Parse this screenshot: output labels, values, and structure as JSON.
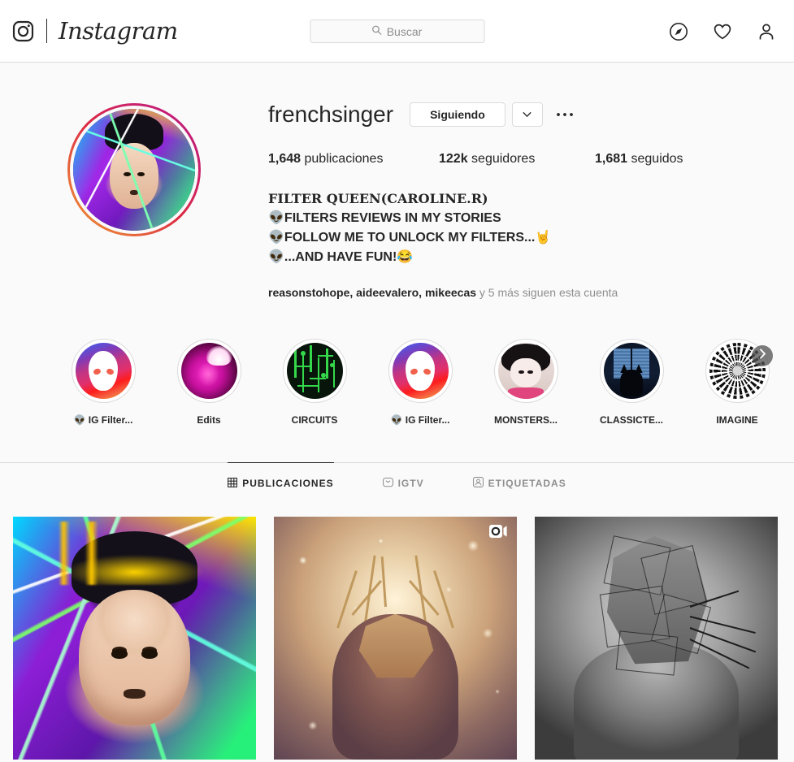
{
  "navbar": {
    "logo_icon": "instagram-camera-icon",
    "wordmark": "Instagram",
    "search": {
      "placeholder": "Buscar",
      "value": "",
      "icon": "search-icon"
    },
    "icons": [
      {
        "name": "explore-compass-icon"
      },
      {
        "name": "activity-heart-icon"
      },
      {
        "name": "profile-person-icon"
      }
    ]
  },
  "profile": {
    "username": "frenchsinger",
    "follow_button_label": "Siguiendo",
    "caret_icon": "chevron-down-icon",
    "options_icon": "more-options-icon",
    "stats": [
      {
        "value": "1,648",
        "label": "publicaciones"
      },
      {
        "value": "122k",
        "label": "seguidores"
      },
      {
        "value": "1,681",
        "label": "seguidos"
      }
    ],
    "bio": [
      "FILTER QUEEN(CAROLINE.R)",
      "👽FILTERS REVIEWS IN MY STORIES",
      "👽FOLLOW ME TO UNLOCK MY FILTERS...🤘",
      "👽...AND HAVE FUN!😂"
    ],
    "mutuals": {
      "names": "reasonstohope, aideevalero, mikeecas",
      "suffix": " y 5 más siguen esta cuenta"
    }
  },
  "highlights": {
    "next_icon": "chevron-right-icon",
    "items": [
      {
        "label": "👽 IG Filter...",
        "art": "alien"
      },
      {
        "label": "Edits",
        "art": "edits"
      },
      {
        "label": "CIRCUITS",
        "art": "circuit"
      },
      {
        "label": "👽 IG Filter...",
        "art": "alien"
      },
      {
        "label": "MONSTERS...",
        "art": "monster"
      },
      {
        "label": "CLASSICTE...",
        "art": "classic"
      },
      {
        "label": "IMAGINE",
        "art": "spiral"
      }
    ]
  },
  "tabs": [
    {
      "label": "PUBLICACIONES",
      "icon": "grid-icon",
      "active": true
    },
    {
      "label": "IGTV",
      "icon": "igtv-icon",
      "active": false
    },
    {
      "label": "ETIQUETADAS",
      "icon": "tagged-person-icon",
      "active": false
    }
  ],
  "grid": [
    {
      "art": "neon",
      "badge": null
    },
    {
      "art": "gold",
      "badge": "video-carousel-icon"
    },
    {
      "art": "bw",
      "badge": null
    }
  ],
  "colors": {
    "background": "#fafafa",
    "surface": "#ffffff",
    "border": "#dbdbdb",
    "text": "#262626",
    "muted": "#8e8e8e"
  }
}
